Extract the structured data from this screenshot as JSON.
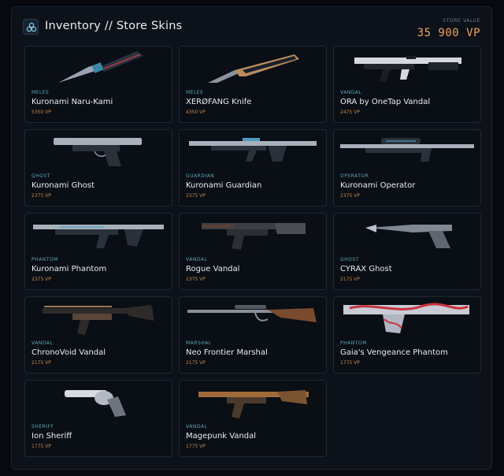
{
  "header": {
    "title": "Inventory // Store Skins",
    "store_value_label": "STORE VALUE",
    "store_value": "35 900 VP"
  },
  "colors": {
    "accent_orange": "#f0a254",
    "type_label": "#5fa7b8",
    "price": "#c98a4a",
    "card_bg": "#0a0e15"
  },
  "items": [
    {
      "type": "MELEE",
      "name": "Kuronami Naru-Kami",
      "price": "5350 VP",
      "icon": "knife-icon"
    },
    {
      "type": "MELEE",
      "name": "XERØFANG Knife",
      "price": "4350 VP",
      "icon": "knife-icon"
    },
    {
      "type": "VANDAL",
      "name": "ORA by OneTap Vandal",
      "price": "2475 VP",
      "icon": "rifle-icon"
    },
    {
      "type": "GHOST",
      "name": "Kuronami Ghost",
      "price": "2375 VP",
      "icon": "pistol-icon"
    },
    {
      "type": "GUARDIAN",
      "name": "Kuronami Guardian",
      "price": "2375 VP",
      "icon": "rifle-icon"
    },
    {
      "type": "OPERATOR",
      "name": "Kuronami Operator",
      "price": "2375 VP",
      "icon": "sniper-icon"
    },
    {
      "type": "PHANTOM",
      "name": "Kuronami Phantom",
      "price": "2375 VP",
      "icon": "rifle-icon"
    },
    {
      "type": "VANDAL",
      "name": "Rogue Vandal",
      "price": "2375 VP",
      "icon": "rifle-icon"
    },
    {
      "type": "GHOST",
      "name": "CYRAX Ghost",
      "price": "2175 VP",
      "icon": "pistol-icon"
    },
    {
      "type": "VANDAL",
      "name": "ChronoVoid Vandal",
      "price": "2175 VP",
      "icon": "rifle-icon"
    },
    {
      "type": "MARSHAL",
      "name": "Neo Frontier Marshal",
      "price": "2175 VP",
      "icon": "sniper-icon"
    },
    {
      "type": "PHANTOM",
      "name": "Gaia's Vengeance Phantom",
      "price": "1775 VP",
      "icon": "rifle-icon"
    },
    {
      "type": "SHERIFF",
      "name": "Ion Sheriff",
      "price": "1775 VP",
      "icon": "revolver-icon"
    },
    {
      "type": "VANDAL",
      "name": "Magepunk Vandal",
      "price": "1775 VP",
      "icon": "rifle-icon"
    }
  ]
}
